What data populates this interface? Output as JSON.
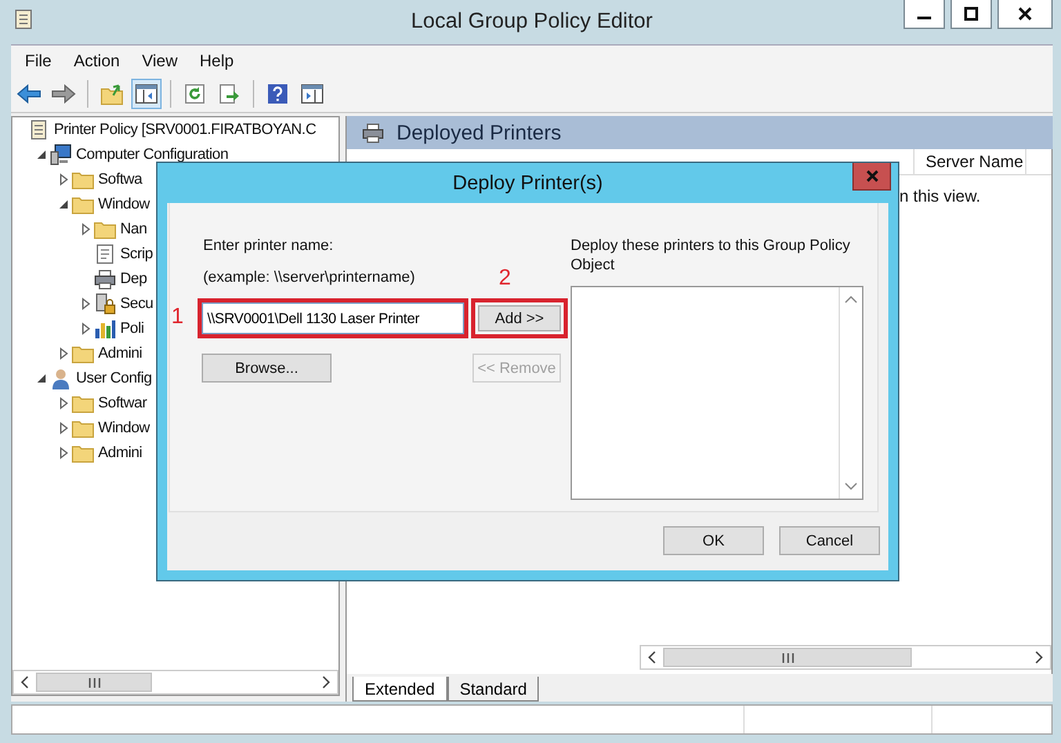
{
  "window": {
    "title": "Local Group Policy Editor"
  },
  "menu": [
    "File",
    "Action",
    "View",
    "Help"
  ],
  "toolbar": [
    {
      "kind": "back",
      "pressed": false
    },
    {
      "kind": "forward",
      "pressed": false
    },
    {
      "kind": "sep"
    },
    {
      "kind": "up",
      "pressed": false
    },
    {
      "kind": "tree",
      "pressed": true
    },
    {
      "kind": "sep"
    },
    {
      "kind": "refresh",
      "pressed": false
    },
    {
      "kind": "export",
      "pressed": false
    },
    {
      "kind": "sep"
    },
    {
      "kind": "help",
      "pressed": false
    },
    {
      "kind": "pane",
      "pressed": false
    }
  ],
  "tree": [
    {
      "label": "Printer Policy [SRV0001.FIRATBOYAN.C",
      "kind": "policy",
      "children": [
        {
          "label": "Computer Configuration",
          "kind": "computer",
          "expanded": true,
          "children": [
            {
              "label": "Softwa",
              "kind": "folder",
              "expanded": false
            },
            {
              "label": "Window",
              "kind": "folder",
              "expanded": true,
              "children": [
                {
                  "label": "Nan",
                  "kind": "folder",
                  "expanded": false
                },
                {
                  "label": "Scrip",
                  "kind": "script"
                },
                {
                  "label": "Dep",
                  "kind": "printer"
                },
                {
                  "label": "Secu",
                  "kind": "security",
                  "expanded": false
                },
                {
                  "label": "Poli",
                  "kind": "chart",
                  "expanded": false
                }
              ]
            },
            {
              "label": "Admini",
              "kind": "folder",
              "expanded": false
            }
          ]
        },
        {
          "label": "User Config",
          "kind": "user",
          "expanded": true,
          "children": [
            {
              "label": "Softwar",
              "kind": "folder",
              "expanded": false
            },
            {
              "label": "Window",
              "kind": "folder",
              "expanded": false
            },
            {
              "label": "Admini",
              "kind": "folder",
              "expanded": false
            }
          ]
        }
      ]
    }
  ],
  "details": {
    "title": "Deployed Printers",
    "columns": [
      "Server Name"
    ],
    "message": "n this view."
  },
  "tabs": [
    {
      "label": "Extended",
      "selected": true
    },
    {
      "label": "Standard",
      "selected": false
    }
  ],
  "dialog": {
    "title": "Deploy Printer(s)",
    "name_label": "Enter printer name:",
    "example": "(example: \\\\server\\printername)",
    "name_value": "\\\\SRV0001\\Dell 1130 Laser Printer",
    "add_button": {
      "label": "Add >>",
      "disabled": false
    },
    "browse_button": {
      "label": "Browse...",
      "disabled": false
    },
    "remove_button": {
      "label": "<< Remove",
      "disabled": true
    },
    "list_label": "Deploy these printers to this Group Policy Object",
    "ok_button": "OK",
    "cancel_button": "Cancel"
  },
  "annotations": [
    {
      "label": "1"
    },
    {
      "label": "2"
    }
  ]
}
